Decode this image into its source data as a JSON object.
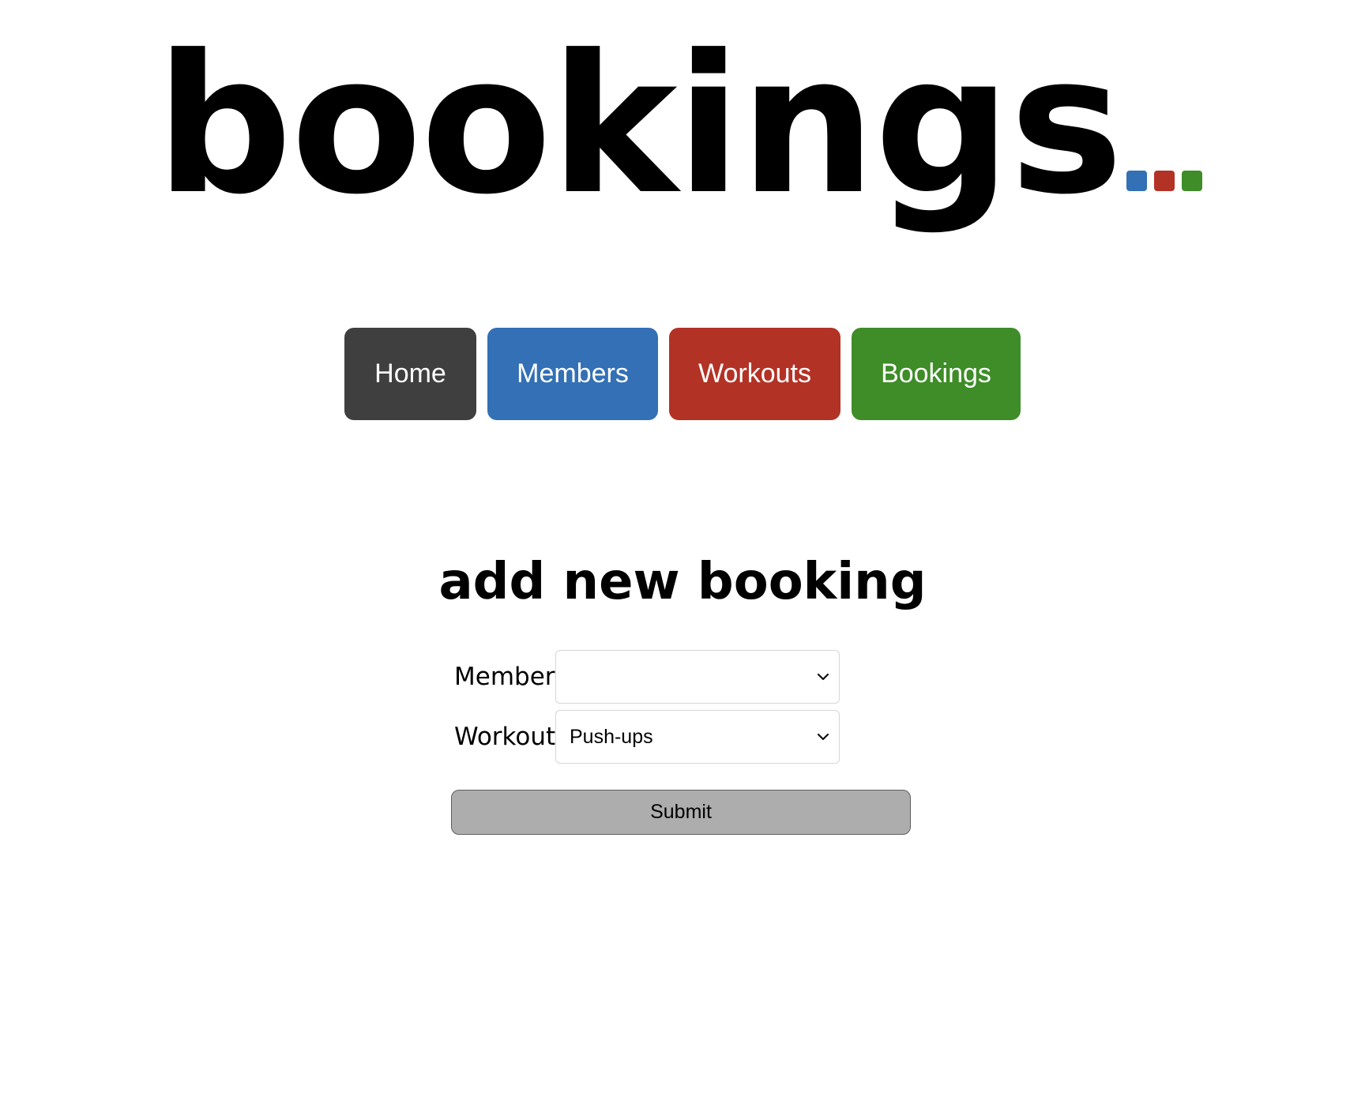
{
  "logo": {
    "text": "bookings",
    "dot_colors": [
      "#3370b5",
      "#b33226",
      "#3e8d28"
    ]
  },
  "nav": {
    "items": [
      {
        "label": "Home",
        "color": "#3f3f3f"
      },
      {
        "label": "Members",
        "color": "#3370b5"
      },
      {
        "label": "Workouts",
        "color": "#b33226"
      },
      {
        "label": "Bookings",
        "color": "#3e8d28"
      }
    ]
  },
  "form": {
    "title": "add new booking",
    "member": {
      "label": "Member",
      "value": ""
    },
    "workout": {
      "label": "Workout",
      "value": "Push-ups"
    },
    "submit_label": "Submit"
  }
}
